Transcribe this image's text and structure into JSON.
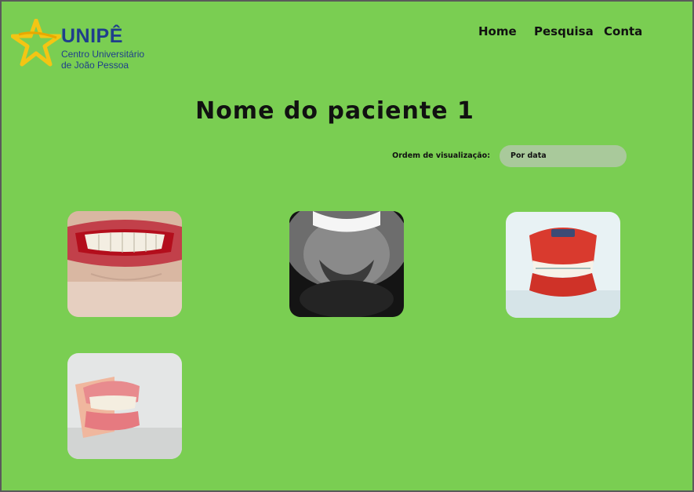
{
  "logo": {
    "title": "UNIPÊ",
    "subtitle_line1": "Centro Universitário",
    "subtitle_line2": "de João Pessoa"
  },
  "nav": {
    "items": [
      {
        "label": "Home"
      },
      {
        "label": "Pesquisa"
      },
      {
        "label": "Conta"
      }
    ]
  },
  "page": {
    "title": "Nome do paciente 1"
  },
  "order": {
    "label": "Ordem de visualização:",
    "selected": "Por data"
  },
  "gallery": {
    "photos": [
      {
        "icon": "smile-red-lips-photo"
      },
      {
        "icon": "smile-bw-photo"
      },
      {
        "icon": "dental-braces-model-photo"
      },
      {
        "icon": "denture-model-photo"
      }
    ]
  },
  "colors": {
    "background": "#7ace52",
    "brand_blue": "#1f3e8c",
    "brand_yellow": "#f3c514",
    "select_bg": "#a9c99b"
  }
}
